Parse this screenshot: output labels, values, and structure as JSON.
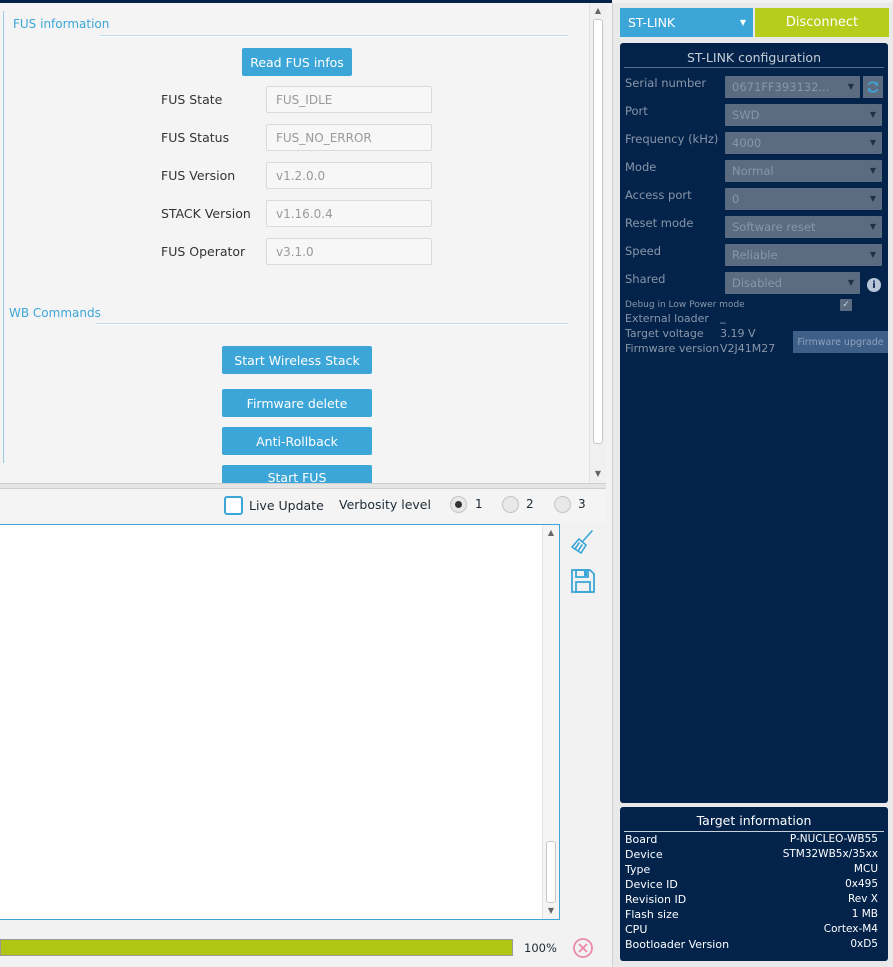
{
  "fus_info": {
    "section_title": "FUS information",
    "read_button": "Read FUS infos",
    "fields": [
      {
        "label": "FUS State",
        "value": "FUS_IDLE"
      },
      {
        "label": "FUS Status",
        "value": "FUS_NO_ERROR"
      },
      {
        "label": "FUS Version",
        "value": "v1.2.0.0"
      },
      {
        "label": "STACK Version",
        "value": "v1.16.0.4"
      },
      {
        "label": "FUS Operator",
        "value": "v3.1.0"
      }
    ]
  },
  "wb_commands": {
    "section_title": "WB Commands",
    "buttons": [
      "Start Wireless Stack",
      "Firmware delete",
      "Anti-Rollback",
      "Start FUS"
    ]
  },
  "log": {
    "live_update_label": "Live Update",
    "live_update_checked": false,
    "verbosity_label": "Verbosity level",
    "verbosity_options": [
      "1",
      "2",
      "3"
    ],
    "verbosity_selected": "1",
    "progress": 1.0,
    "progress_label": "100%",
    "icons": [
      "brush-clear-icon",
      "save-icon",
      "cancel-icon"
    ]
  },
  "connection": {
    "interface": "ST-LINK",
    "disconnect_label": "Disconnect"
  },
  "stlink_config": {
    "title": "ST-LINK configuration",
    "serial_label": "Serial number",
    "serial_value": "0671FF393132...",
    "port_label": "Port",
    "port_value": "SWD",
    "frequency_label": "Frequency (kHz)",
    "frequency_value": "4000",
    "mode_label": "Mode",
    "mode_value": "Normal",
    "access_port_label": "Access port",
    "access_port_value": "0",
    "reset_label": "Reset mode",
    "reset_value": "Software reset",
    "speed_label": "Speed",
    "speed_value": "Reliable",
    "shared_label": "Shared",
    "shared_value": "Disabled",
    "debug_lp_label": "Debug in Low Power mode",
    "ext_loader_label": "External loader",
    "ext_loader_value": "_",
    "voltage_label": "Target voltage",
    "voltage_value": "3.19 V",
    "fw_version_label": "Firmware version",
    "fw_version_value": "V2J41M27",
    "fw_upgrade_label": "Firmware upgrade"
  },
  "target_info": {
    "title": "Target information",
    "rows": [
      {
        "key": "Board",
        "value": "P-NUCLEO-WB55"
      },
      {
        "key": "Device",
        "value": "STM32WB5x/35xx"
      },
      {
        "key": "Type",
        "value": "MCU"
      },
      {
        "key": "Device ID",
        "value": "0x495"
      },
      {
        "key": "Revision ID",
        "value": "Rev X"
      },
      {
        "key": "Flash size",
        "value": "1 MB"
      },
      {
        "key": "CPU",
        "value": "Cortex-M4"
      },
      {
        "key": "Bootloader Version",
        "value": "0xD5"
      }
    ]
  },
  "colors": {
    "accent": "#3ca6d8",
    "navy": "#03234b",
    "lime": "#b7cd1b",
    "progress": "#afc613"
  }
}
